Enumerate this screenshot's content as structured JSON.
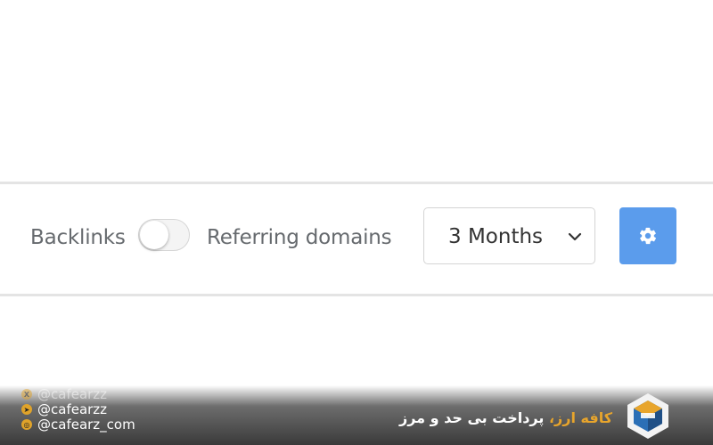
{
  "toolbar": {
    "backlinks_label": "Backlinks",
    "referring_label": "Referring domains",
    "toggle_on": false,
    "period_value": "3 Months",
    "settings_icon": "gear-icon",
    "accent_color": "#5b9cec"
  },
  "watermark": {
    "socials": [
      {
        "icon": "x-icon",
        "handle": "@cafearzz"
      },
      {
        "icon": "telegram-icon",
        "handle": "@cafearzz"
      },
      {
        "icon": "instagram-icon",
        "handle": "@cafearz_com"
      }
    ],
    "brand": "کافه ارز،",
    "slogan": " پرداخت بی حد و مرز"
  }
}
